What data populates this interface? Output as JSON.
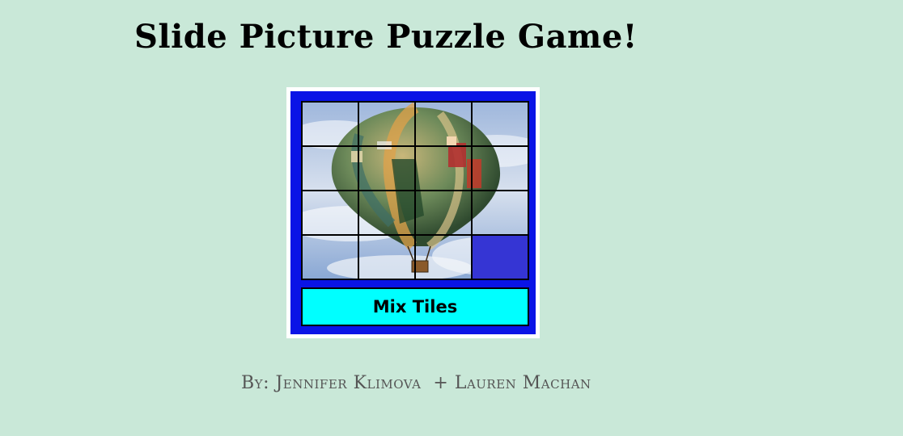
{
  "page": {
    "title": "Slide Picture Puzzle Game!",
    "credits": "By: Jennifer Klimova  + Lauren Machan"
  },
  "puzzle": {
    "rows": 4,
    "columns": 4,
    "picture": "hot-air-balloon",
    "empty_tile": {
      "row": 4,
      "column": 4
    },
    "mix_button_label": "Mix Tiles"
  },
  "colors": {
    "background": "#c9e8d8",
    "panel": "#0a14e6",
    "button": "#00ffff",
    "empty_tile": "#3535d4"
  }
}
